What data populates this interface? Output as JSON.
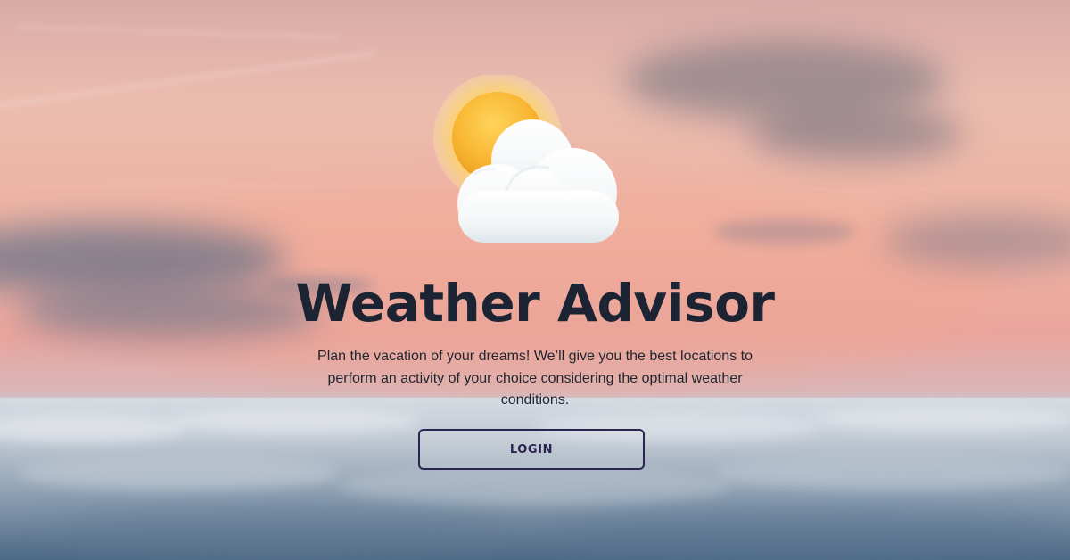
{
  "app": {
    "title": "Weather Advisor",
    "tagline": "Plan the vacation of your dreams! We’ll give you the best locations to perform an activity of your choice considering the optimal weather conditions.",
    "logo_icon": "sun-behind-cloud-icon"
  },
  "actions": {
    "login_label": "LOGIN"
  },
  "colors": {
    "title": "#1c2433",
    "button_border": "#2a2550",
    "sky_top": "#e9b3a9",
    "cloud_sea": "#5f7a93"
  }
}
